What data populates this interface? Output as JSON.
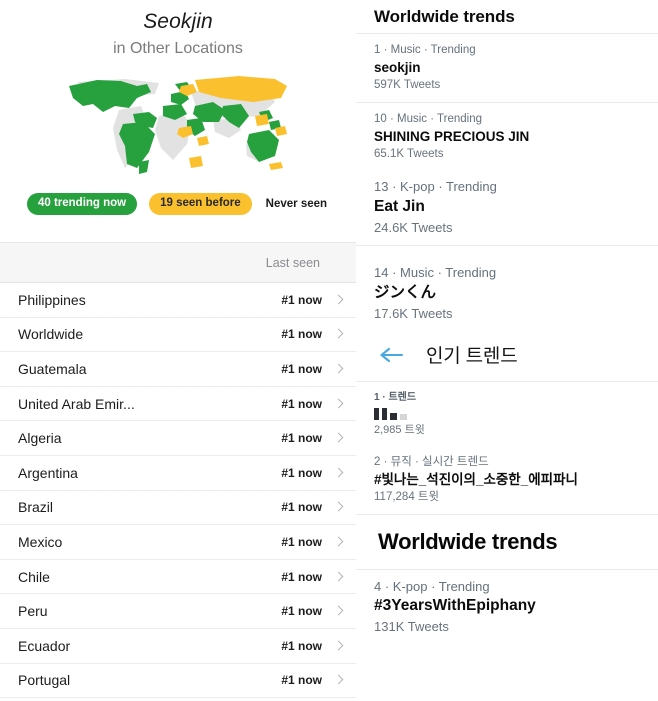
{
  "left": {
    "hero": {
      "title": "Seokjin",
      "subtitle": "in Other Locations"
    },
    "legend": {
      "trending_now": "40 trending now",
      "seen_before": "19 seen before",
      "never_seen": "Never seen",
      "color_trending_now": "#27a03e",
      "color_seen_before": "#fbc02d",
      "color_never_seen": "#dcdcdc"
    },
    "map": {
      "name": "world-map",
      "color_green": "#27a03e",
      "color_yellow": "#fbc02d",
      "color_gray": "#e0e0e0"
    },
    "table": {
      "header_last_seen": "Last seen",
      "rows": [
        {
          "location": "Philippines",
          "status": "#1 now"
        },
        {
          "location": "Worldwide",
          "status": "#1 now"
        },
        {
          "location": "Guatemala",
          "status": "#1 now"
        },
        {
          "location": "United Arab Emir...",
          "status": "#1 now"
        },
        {
          "location": "Algeria",
          "status": "#1 now"
        },
        {
          "location": "Argentina",
          "status": "#1 now"
        },
        {
          "location": "Brazil",
          "status": "#1 now"
        },
        {
          "location": "Mexico",
          "status": "#1 now"
        },
        {
          "location": "Chile",
          "status": "#1 now"
        },
        {
          "location": "Peru",
          "status": "#1 now"
        },
        {
          "location": "Ecuador",
          "status": "#1 now"
        },
        {
          "location": "Portugal",
          "status": "#1 now"
        }
      ]
    }
  },
  "right": {
    "header_1": "Worldwide trends",
    "trends_a": [
      {
        "meta": "1 · Music · Trending",
        "name": "seokjin",
        "count": "597K Tweets"
      }
    ],
    "trends_b": [
      {
        "meta": "10 · Music · Trending",
        "name": "SHINING PRECIOUS JIN",
        "count": "65.1K Tweets"
      },
      {
        "meta": "13 · K-pop · Trending",
        "name": "Eat Jin",
        "count": "24.6K Tweets"
      }
    ],
    "trends_c": [
      {
        "meta": "14 · Music · Trending",
        "name": "ジンくん",
        "count": "17.6K Tweets"
      }
    ],
    "kr_header": {
      "back_icon": "back-arrow-icon",
      "back_icon_color": "#4aa8e0",
      "title": "인기 트렌드"
    },
    "trends_kr": [
      {
        "meta": "1 · 트렌드",
        "name": "",
        "count": "2,985 트윗",
        "redacted": true
      },
      {
        "meta": "2 · 뮤직 · 실시간 트렌드",
        "name": "#빛나는_석진이의_소중한_에피파니",
        "count": "117,284 트윗",
        "redacted": false
      }
    ],
    "header_2": "Worldwide trends",
    "trends_d": [
      {
        "meta": "4 · K-pop · Trending",
        "name": "#3YearsWithEpiphany",
        "count": "131K Tweets"
      }
    ]
  }
}
